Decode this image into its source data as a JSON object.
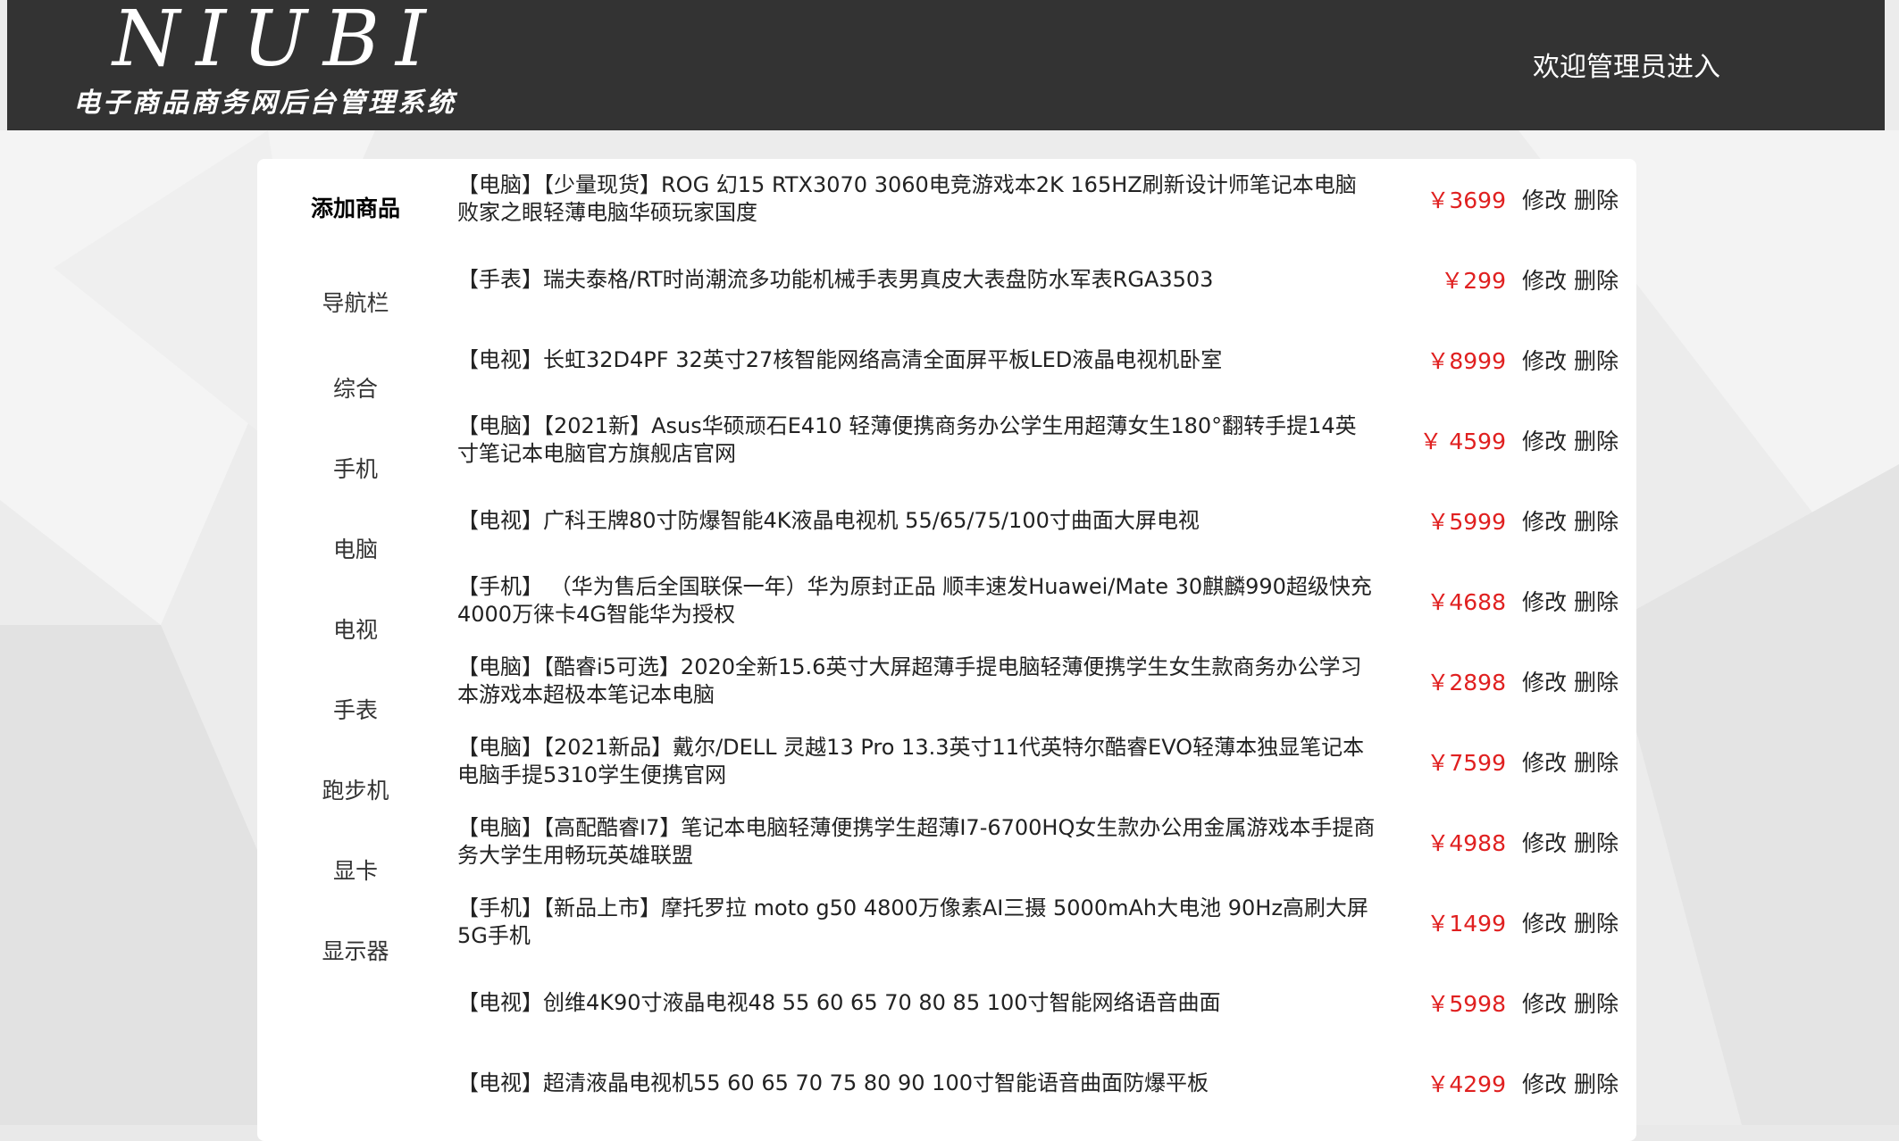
{
  "header": {
    "logo_title": "NIUBI",
    "logo_subtitle": "电子商品商务网后台管理系统",
    "welcome": "欢迎管理员进入"
  },
  "colors": {
    "header_bg": "#333333",
    "price": "#e02020",
    "panel_bg": "#ffffff",
    "page_bg": "#e9e9e9"
  },
  "sidebar": {
    "items": [
      {
        "label": "添加商品"
      },
      {
        "label": "导航栏"
      },
      {
        "label": "综合"
      },
      {
        "label": "手机"
      },
      {
        "label": "电脑"
      },
      {
        "label": "电视"
      },
      {
        "label": "手表"
      },
      {
        "label": "跑步机"
      },
      {
        "label": "显卡"
      },
      {
        "label": "显示器"
      }
    ]
  },
  "products": [
    {
      "name": "【电脑】【少量现货】ROG 幻15 RTX3070 3060电竞游戏本2K 165HZ刷新设计师笔记本电脑败家之眼轻薄电脑华硕玩家国度",
      "price": "￥3699",
      "edit": "修改",
      "delete": "删除"
    },
    {
      "name": "【手表】瑞夫泰格/RT时尚潮流多功能机械手表男真皮大表盘防水军表RGA3503",
      "price": "￥299",
      "edit": "修改",
      "delete": "删除"
    },
    {
      "name": "【电视】长虹32D4PF 32英寸27核智能网络高清全面屏平板LED液晶电视机卧室",
      "price": "￥8999",
      "edit": "修改",
      "delete": "删除"
    },
    {
      "name": "【电脑】【2021新】Asus华硕顽石E410 轻薄便携商务办公学生用超薄女生180°翻转手提14英寸笔记本电脑官方旗舰店官网",
      "price": "￥ 4599",
      "edit": "修改",
      "delete": "删除"
    },
    {
      "name": "【电视】广科王牌80寸防爆智能4K液晶电视机 55/65/75/100寸曲面大屏电视",
      "price": "￥5999",
      "edit": "修改",
      "delete": "删除"
    },
    {
      "name": "【手机】 （华为售后全国联保一年）华为原封正品 顺丰速发Huawei/Mate 30麒麟990超级快充4000万徕卡4G智能华为授权",
      "price": "￥4688",
      "edit": "修改",
      "delete": "删除"
    },
    {
      "name": "【电脑】【酷睿i5可选】2020全新15.6英寸大屏超薄手提电脑轻薄便携学生女生款商务办公学习本游戏本超极本笔记本电脑",
      "price": "￥2898",
      "edit": "修改",
      "delete": "删除"
    },
    {
      "name": "【电脑】【2021新品】戴尔/DELL 灵越13 Pro 13.3英寸11代英特尔酷睿EVO轻薄本独显笔记本电脑手提5310学生便携官网",
      "price": "￥7599",
      "edit": "修改",
      "delete": "删除"
    },
    {
      "name": "【电脑】【高配酷睿I7】笔记本电脑轻薄便携学生超薄I7-6700HQ女生款办公用金属游戏本手提商务大学生用畅玩英雄联盟",
      "price": "￥4988",
      "edit": "修改",
      "delete": "删除"
    },
    {
      "name": "【手机】【新品上市】摩托罗拉 moto g50 4800万像素AI三摄 5000mAh大电池 90Hz高刷大屏5G手机",
      "price": "￥1499",
      "edit": "修改",
      "delete": "删除"
    },
    {
      "name": "【电视】创维4K90寸液晶电视48 55 60 65 70 80 85 100寸智能网络语音曲面",
      "price": "￥5998",
      "edit": "修改",
      "delete": "删除"
    },
    {
      "name": "【电视】超清液晶电视机55 60 65 70 75 80 90 100寸智能语音曲面防爆平板",
      "price": "￥4299",
      "edit": "修改",
      "delete": "删除"
    }
  ]
}
